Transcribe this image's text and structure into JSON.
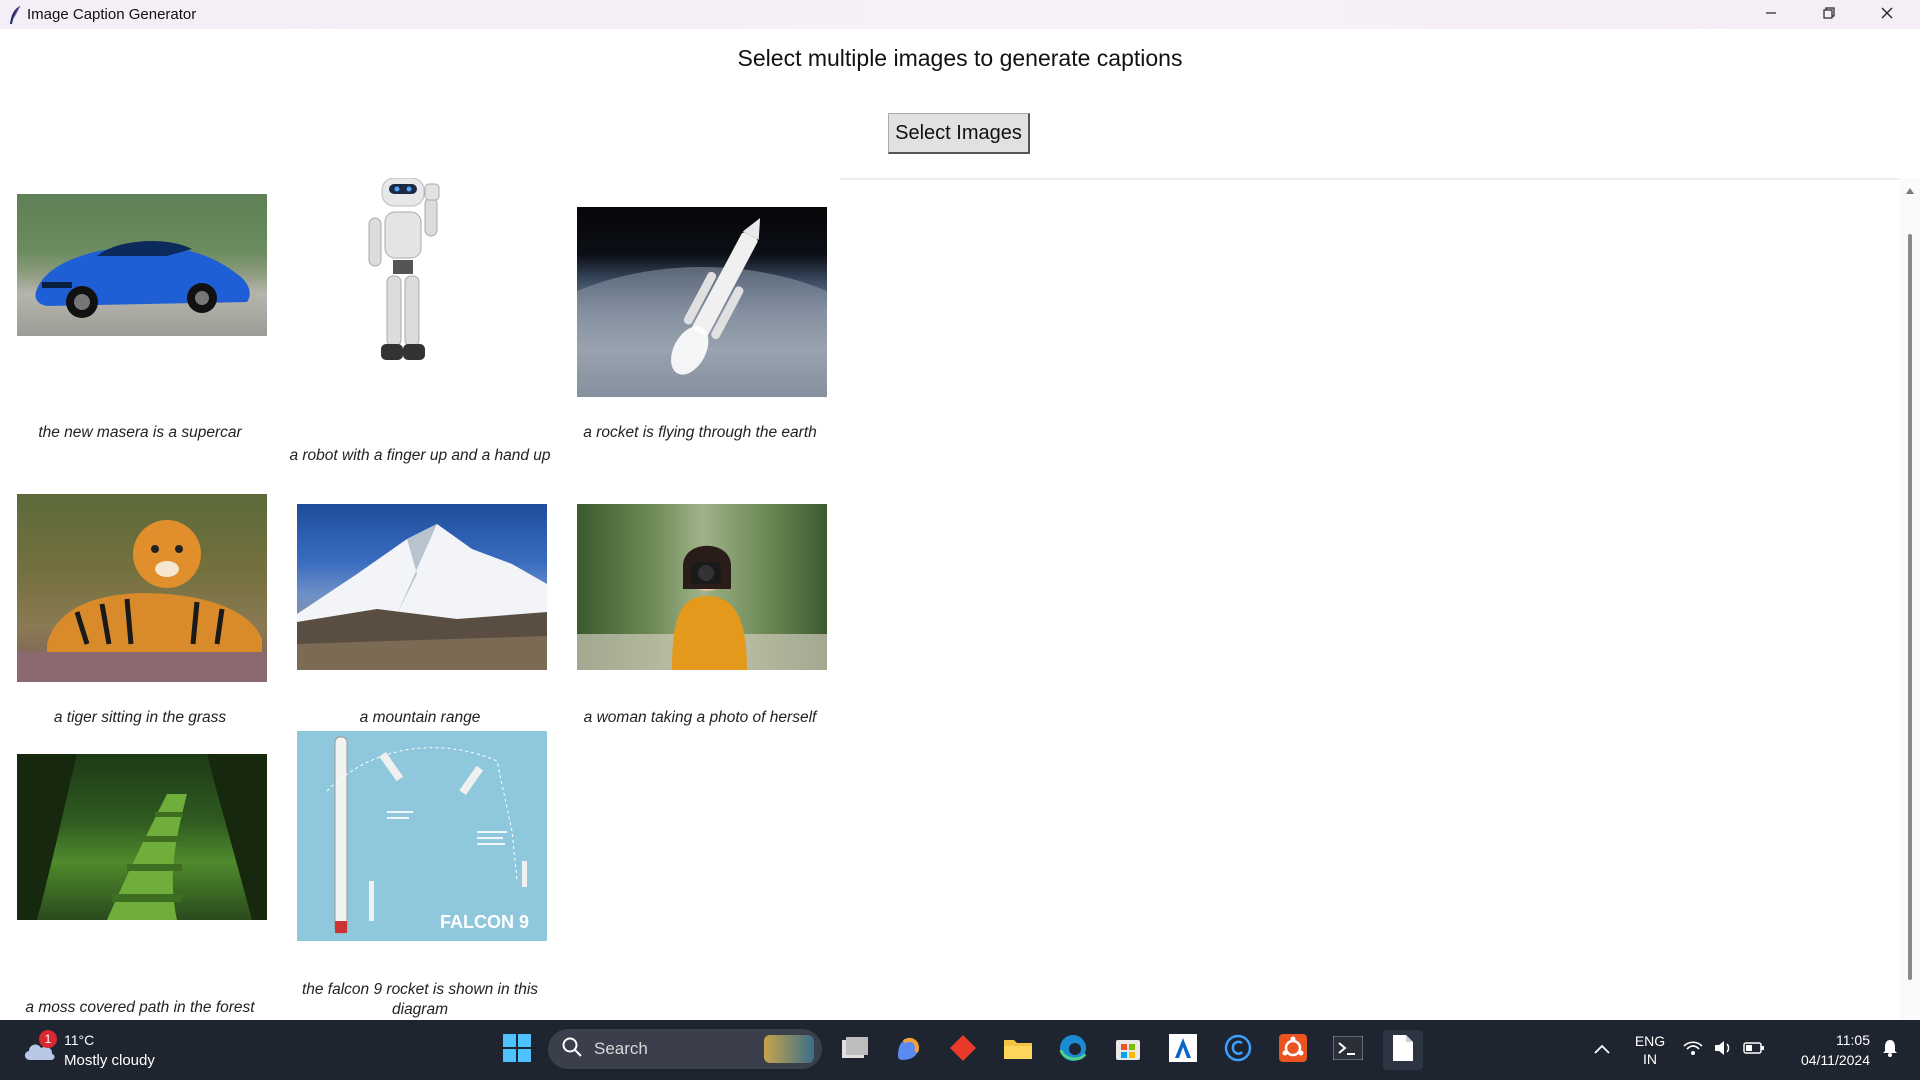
{
  "window": {
    "title": "Image Caption Generator"
  },
  "header": {
    "text": "Select multiple images to generate captions"
  },
  "select_button": {
    "label": "Select Images"
  },
  "images": [
    {
      "caption": "the new masera is a supercar"
    },
    {
      "caption": "a robot with a finger up and a hand up"
    },
    {
      "caption": "a rocket is flying through the earth"
    },
    {
      "caption": "a tiger sitting in the grass"
    },
    {
      "caption": "a mountain range"
    },
    {
      "caption": "a woman taking a photo of herself"
    },
    {
      "caption": "a moss covered path in the forest"
    },
    {
      "caption": "the falcon 9 rocket is shown in this diagram",
      "diagram_label": "FALCON 9"
    }
  ],
  "taskbar": {
    "weather": {
      "temp": "11°C",
      "desc": "Mostly cloudy",
      "badge": "1"
    },
    "search_placeholder": "Search",
    "lang_top": "ENG",
    "lang_bottom": "IN",
    "time": "11:05",
    "date": "04/11/2024"
  }
}
